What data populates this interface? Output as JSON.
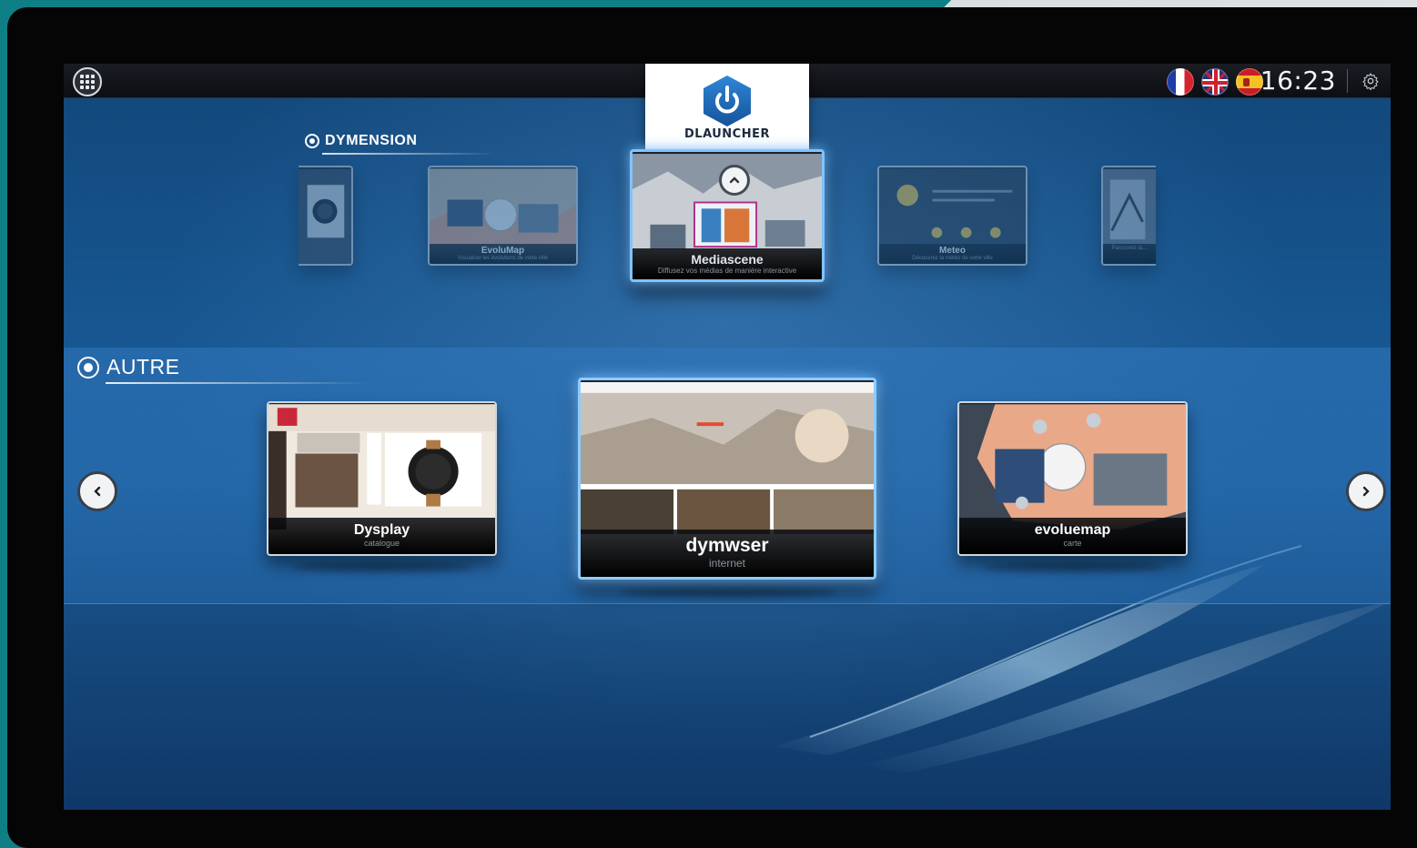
{
  "topbar": {
    "clock": "16:23",
    "languages": [
      "fr",
      "en",
      "es"
    ]
  },
  "launcher": {
    "name": "DLAUNCHER",
    "icon": "power-icon"
  },
  "sections": {
    "dymension": {
      "title": "DYMENSION",
      "cards": [
        {
          "name": "",
          "subtitle": ""
        },
        {
          "name": "EvoluMap",
          "subtitle": "Visualiser les évolutions de votre ville"
        },
        {
          "name": "Mediascene",
          "subtitle": "Diffusez vos médias de manière interactive"
        },
        {
          "name": "Meteo",
          "subtitle": "Découvrez la météo de votre ville"
        },
        {
          "name": "",
          "subtitle": "Parcourez la..."
        }
      ]
    },
    "autre": {
      "title": "AUTRE",
      "cards": [
        {
          "name": "Dysplay",
          "subtitle": "catalogue"
        },
        {
          "name": "dymwser",
          "subtitle": "internet"
        },
        {
          "name": "evoluemap",
          "subtitle": "carte"
        }
      ]
    }
  },
  "colors": {
    "accent_glow": "#7fc4ff",
    "screen_blue": "#175690",
    "bezel": "#050505"
  }
}
